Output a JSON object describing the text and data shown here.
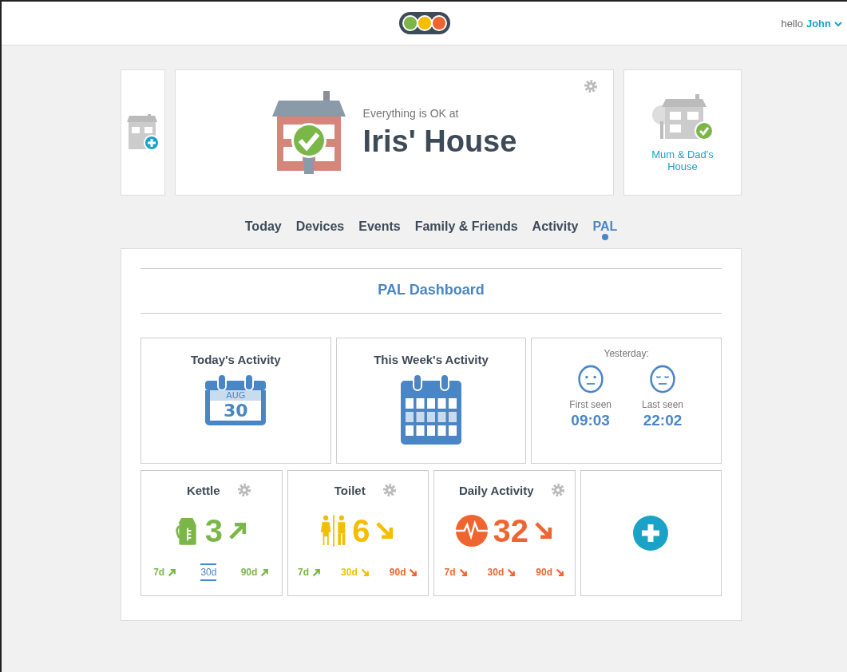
{
  "header": {
    "greeting": "hello",
    "user_name": "John"
  },
  "houses": {
    "status": "Everything is OK at",
    "current": "Iris' House",
    "other": "Mum & Dad's House"
  },
  "tabs": [
    {
      "label": "Today",
      "selected": false
    },
    {
      "label": "Devices",
      "selected": false
    },
    {
      "label": "Events",
      "selected": false
    },
    {
      "label": "Family & Friends",
      "selected": false
    },
    {
      "label": "Activity",
      "selected": false
    },
    {
      "label": "PAL",
      "selected": true
    }
  ],
  "dashboard": {
    "title": "PAL Dashboard",
    "summary": [
      {
        "kind": "day",
        "title": "Today's Activity",
        "month": "AUG",
        "day": "30"
      },
      {
        "kind": "week",
        "title": "This Week's Activity"
      },
      {
        "kind": "yesterday",
        "title": "Yesterday:",
        "first_label": "First seen",
        "first_time": "09:03",
        "last_label": "Last seen",
        "last_time": "22:02"
      }
    ],
    "sensors": [
      {
        "kind": "kettle",
        "name": "Kettle",
        "value": "3",
        "rising": true,
        "color": "#7ab648",
        "periods": [
          {
            "label": "7d",
            "rising": true,
            "color": "#7ab648",
            "selected": false
          },
          {
            "label": "30d",
            "color": "#4a86c5",
            "selected": true
          },
          {
            "label": "90d",
            "rising": true,
            "color": "#7ab648",
            "selected": false
          }
        ]
      },
      {
        "kind": "toilet",
        "name": "Toilet",
        "value": "6",
        "rising": false,
        "color": "#f5bd00",
        "periods": [
          {
            "label": "7d",
            "rising": true,
            "color": "#7ab648",
            "selected": false
          },
          {
            "label": "30d",
            "rising": false,
            "color": "#f5bd00",
            "selected": false
          },
          {
            "label": "90d",
            "rising": false,
            "color": "#ef6530",
            "selected": false
          }
        ]
      },
      {
        "kind": "activity",
        "name": "Daily Activity",
        "value": "32",
        "rising": false,
        "color": "#ef6530",
        "periods": [
          {
            "label": "7d",
            "rising": false,
            "color": "#ef6530",
            "selected": false
          },
          {
            "label": "30d",
            "rising": false,
            "color": "#ef6530",
            "selected": false
          },
          {
            "label": "90d",
            "rising": false,
            "color": "#ef6530",
            "selected": false
          }
        ]
      }
    ]
  }
}
